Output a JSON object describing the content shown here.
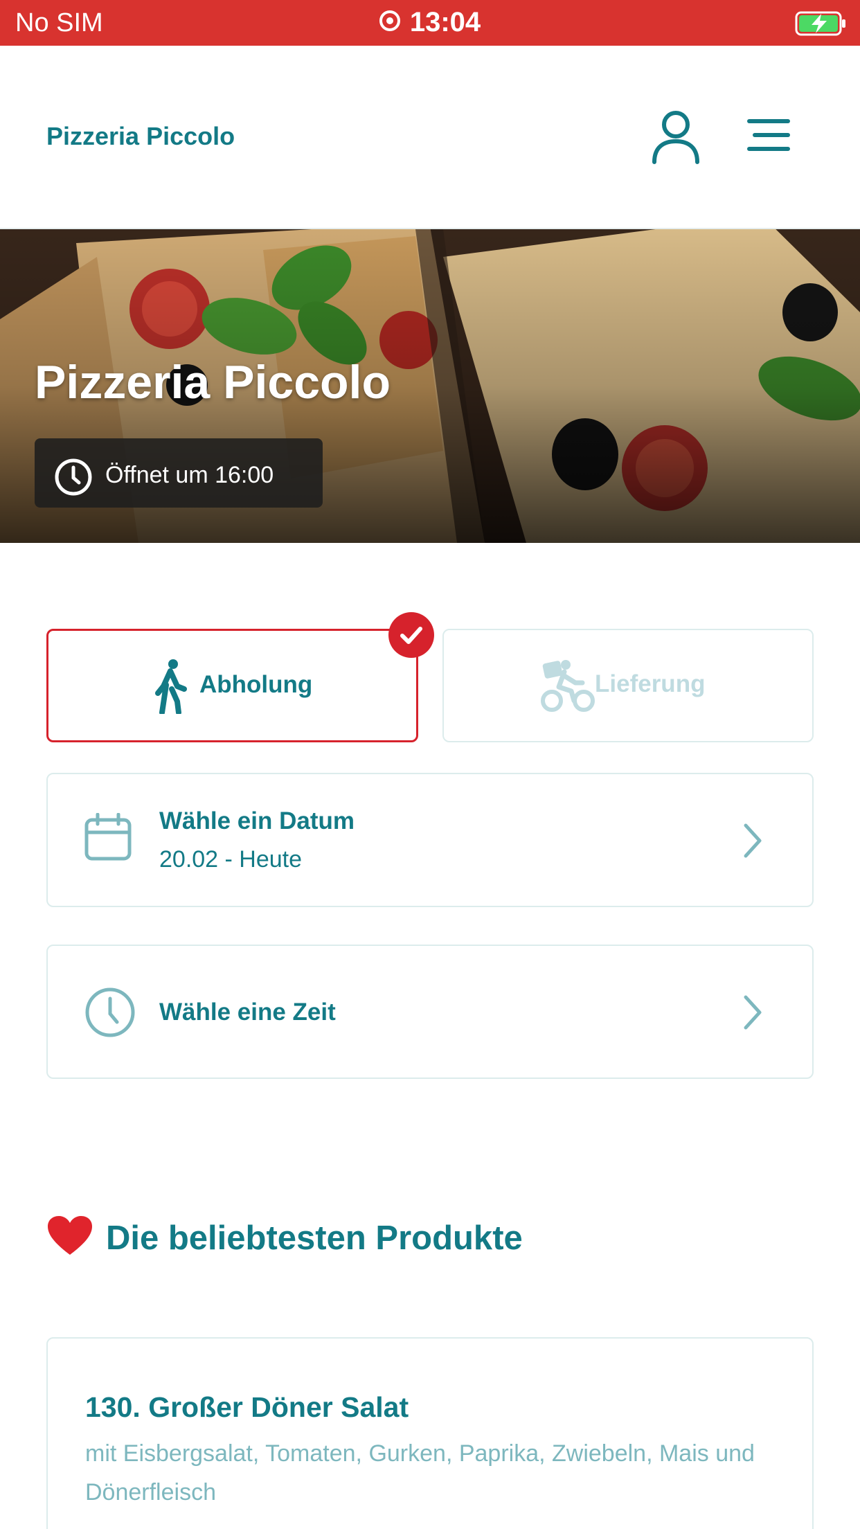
{
  "status_bar": {
    "carrier": "No SIM",
    "time": "13:04",
    "icons": [
      "screen-recording-icon",
      "battery-charging-icon"
    ]
  },
  "header": {
    "brand": "Pizzeria Piccolo",
    "icons": [
      "user-icon",
      "menu-icon"
    ]
  },
  "hero": {
    "title": "Pizzeria Piccolo",
    "opening": "Öffnet um 16:00"
  },
  "order_mode": {
    "pickup_label": "Abholung",
    "delivery_label": "Lieferung",
    "selected": "pickup"
  },
  "date_selector": {
    "title": "Wähle ein Datum",
    "value": "20.02 - Heute"
  },
  "time_selector": {
    "title": "Wähle eine Zeit"
  },
  "popular": {
    "title": "Die beliebtesten Produkte",
    "products": [
      {
        "name": "130. Großer Döner Salat",
        "description": "mit Eisbergsalat, Tomaten, Gurken, Paprika, Zwiebeln, Mais und Dönerfleisch",
        "price": ""
      }
    ]
  },
  "colors": {
    "status_bar": "#d8332f",
    "primary": "#137a86",
    "accent_red": "#d6222c",
    "muted": "#7db7be",
    "border": "#dcecec"
  }
}
